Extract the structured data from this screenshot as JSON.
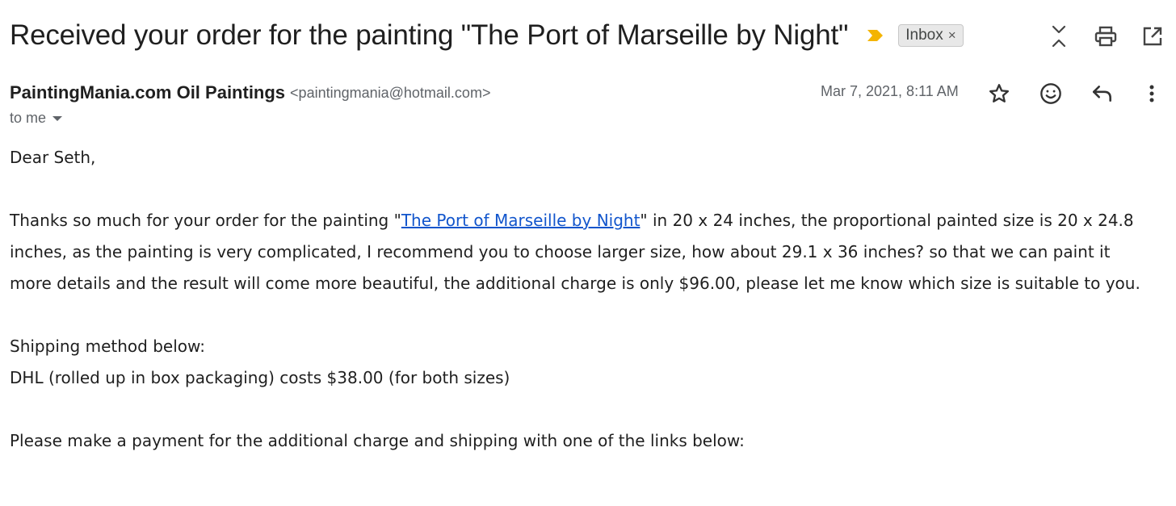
{
  "email": {
    "subject": "Received your order for the painting \"The Port of Marseille by Night\"",
    "label": "Inbox",
    "sender_name": "PaintingMania.com Oil Paintings",
    "sender_email": "<paintingmania@hotmail.com>",
    "date": "Mar 7, 2021, 8:11 AM",
    "recipient": "to me",
    "greeting": "Dear Seth,",
    "para1_before": "Thanks so much for your order for the painting \"",
    "para1_link": "The Port of Marseille by Night",
    "para1_after": "\" in 20 x 24 inches, the proportional painted size is 20 x 24.8 inches, as the painting is very complicated, I recommend you to choose larger size, how about 29.1 x 36 inches? so that we can paint it more details and the result will come more beautiful, the additional charge is only $96.00, please let me know which size is suitable to you.",
    "shipping_heading": "Shipping method below:",
    "shipping_line": "DHL (rolled up in box packaging) costs $38.00 (for both sizes)",
    "payment_line": "Please make a payment for the additional charge and shipping with one of the links below:"
  },
  "icons": {
    "important": "important-marker-icon",
    "chip_remove": "×",
    "collapse": "collapse-all-icon",
    "print": "print-icon",
    "new_window": "open-in-new-window-icon",
    "star": "star-icon",
    "emoji": "emoji-reaction-icon",
    "reply": "reply-icon",
    "more": "more-vert-icon"
  },
  "colors": {
    "important": "#f4b400",
    "link": "#1155cc",
    "chip_bg": "#e8e8e8"
  }
}
